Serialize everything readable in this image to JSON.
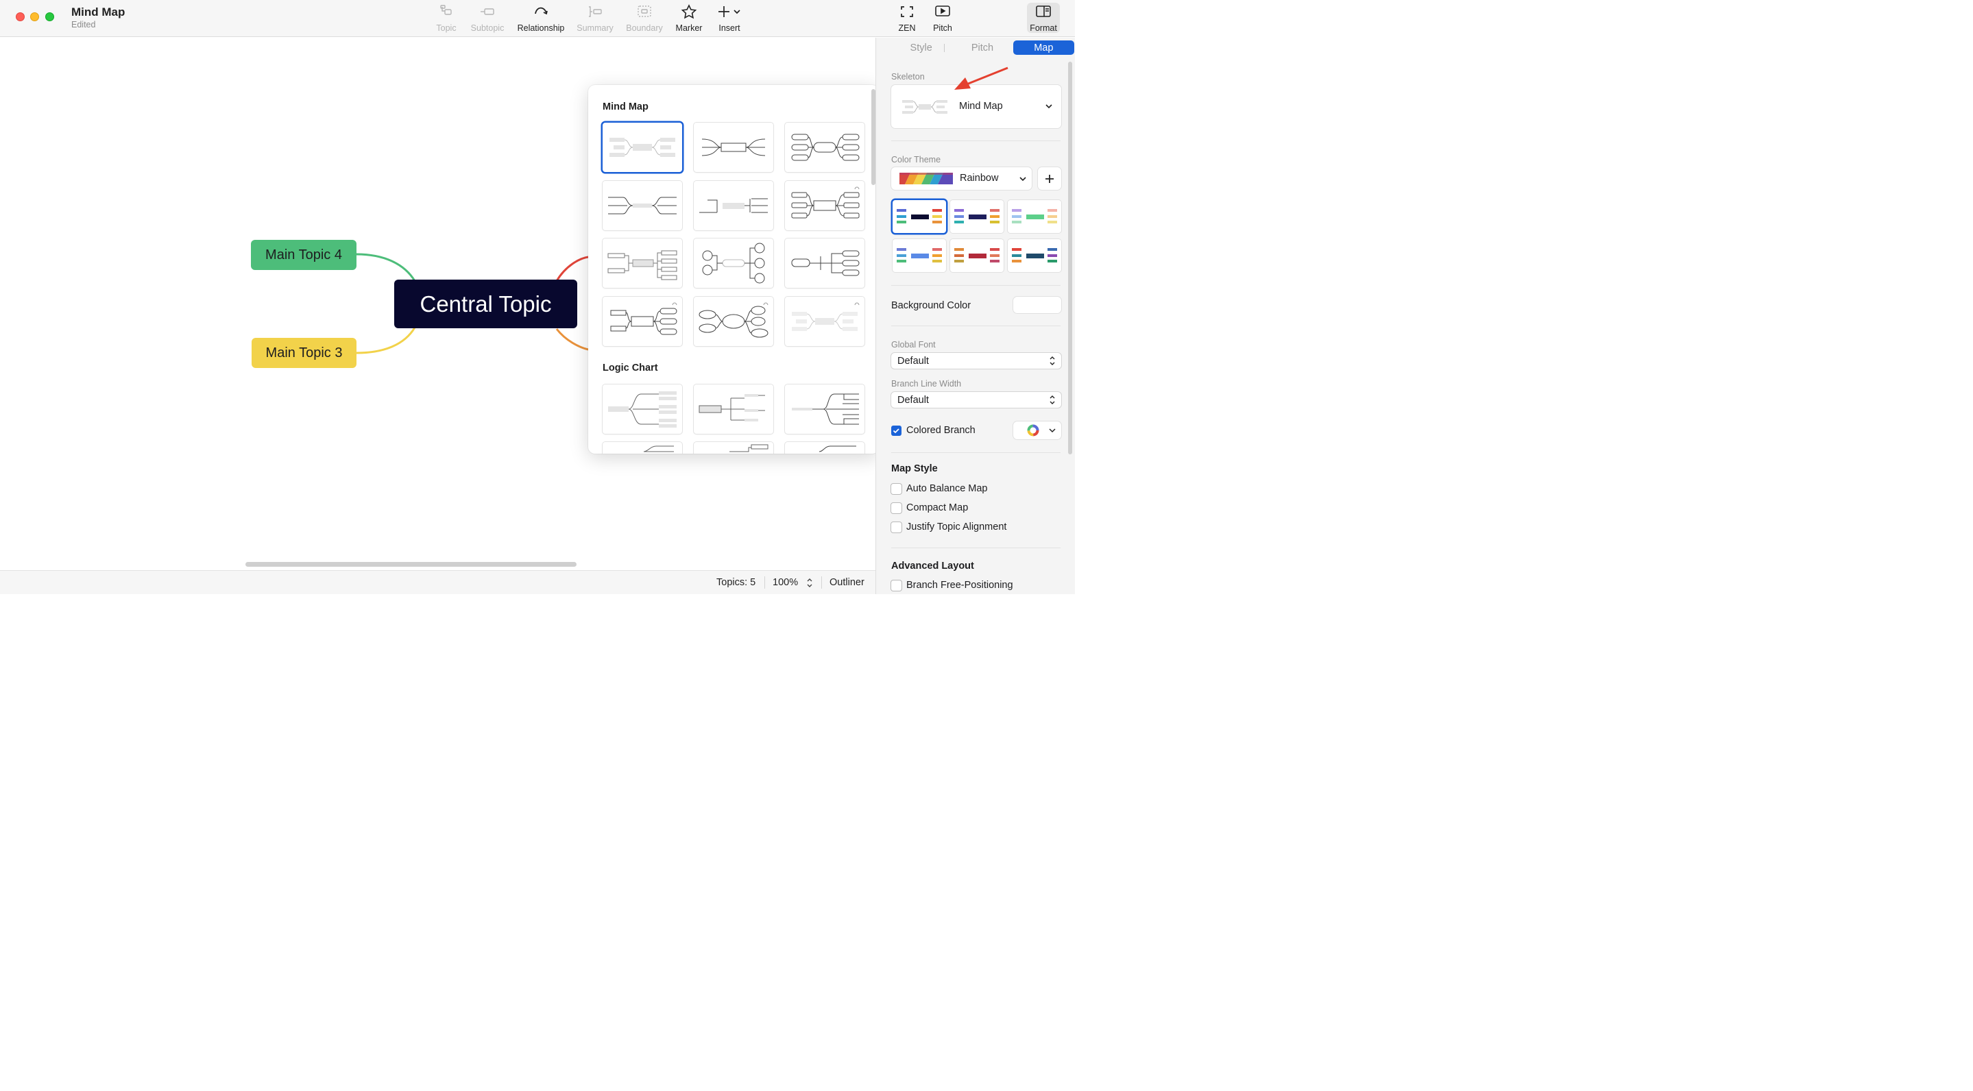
{
  "window": {
    "title": "Mind Map",
    "subtitle": "Edited"
  },
  "toolbar": {
    "topic": "Topic",
    "subtopic": "Subtopic",
    "relationship": "Relationship",
    "summary": "Summary",
    "boundary": "Boundary",
    "marker": "Marker",
    "insert": "Insert",
    "zen": "ZEN",
    "pitch": "Pitch",
    "format": "Format"
  },
  "canvas": {
    "central": "Central Topic",
    "topic4": "Main Topic 4",
    "topic3": "Main Topic 3"
  },
  "colors": {
    "accent": "#1b63d8",
    "central": "#08082e",
    "topic4": "#4dbd7a",
    "topic3": "#f2d24a",
    "line_red": "#e0453a",
    "line_orange": "#e9923b"
  },
  "popover": {
    "section1": "Mind Map",
    "section2": "Logic Chart"
  },
  "status": {
    "topics": "Topics: 5",
    "zoom": "100%",
    "outliner": "Outliner"
  },
  "panel": {
    "tabs": {
      "style": "Style",
      "pitch": "Pitch",
      "map": "Map"
    },
    "skeleton_label": "Skeleton",
    "skeleton_value": "Mind Map",
    "color_theme_label": "Color Theme",
    "color_theme_value": "Rainbow",
    "background_color": "Background Color",
    "global_font_label": "Global Font",
    "global_font_value": "Default",
    "branch_line_label": "Branch Line Width",
    "branch_line_value": "Default",
    "colored_branch": "Colored Branch",
    "map_style": "Map Style",
    "auto_balance": "Auto Balance Map",
    "compact": "Compact Map",
    "justify": "Justify Topic Alignment",
    "advanced": "Advanced Layout",
    "free_pos": "Branch Free-Positioning",
    "theme_thumb_text": "Central Topic"
  }
}
